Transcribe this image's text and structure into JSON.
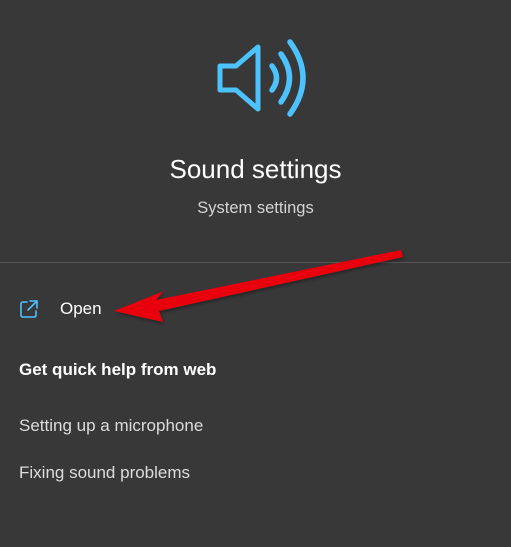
{
  "hero": {
    "icon": "speaker-icon",
    "title": "Sound settings",
    "subtitle": "System settings"
  },
  "actions": {
    "open_icon": "open-external-icon",
    "open_label": "Open"
  },
  "help": {
    "heading": "Get quick help from web",
    "links": [
      "Setting up a microphone",
      "Fixing sound problems"
    ]
  },
  "colors": {
    "background": "#383838",
    "accent": "#4cc2ff",
    "annotation_arrow": "#e8000b"
  }
}
